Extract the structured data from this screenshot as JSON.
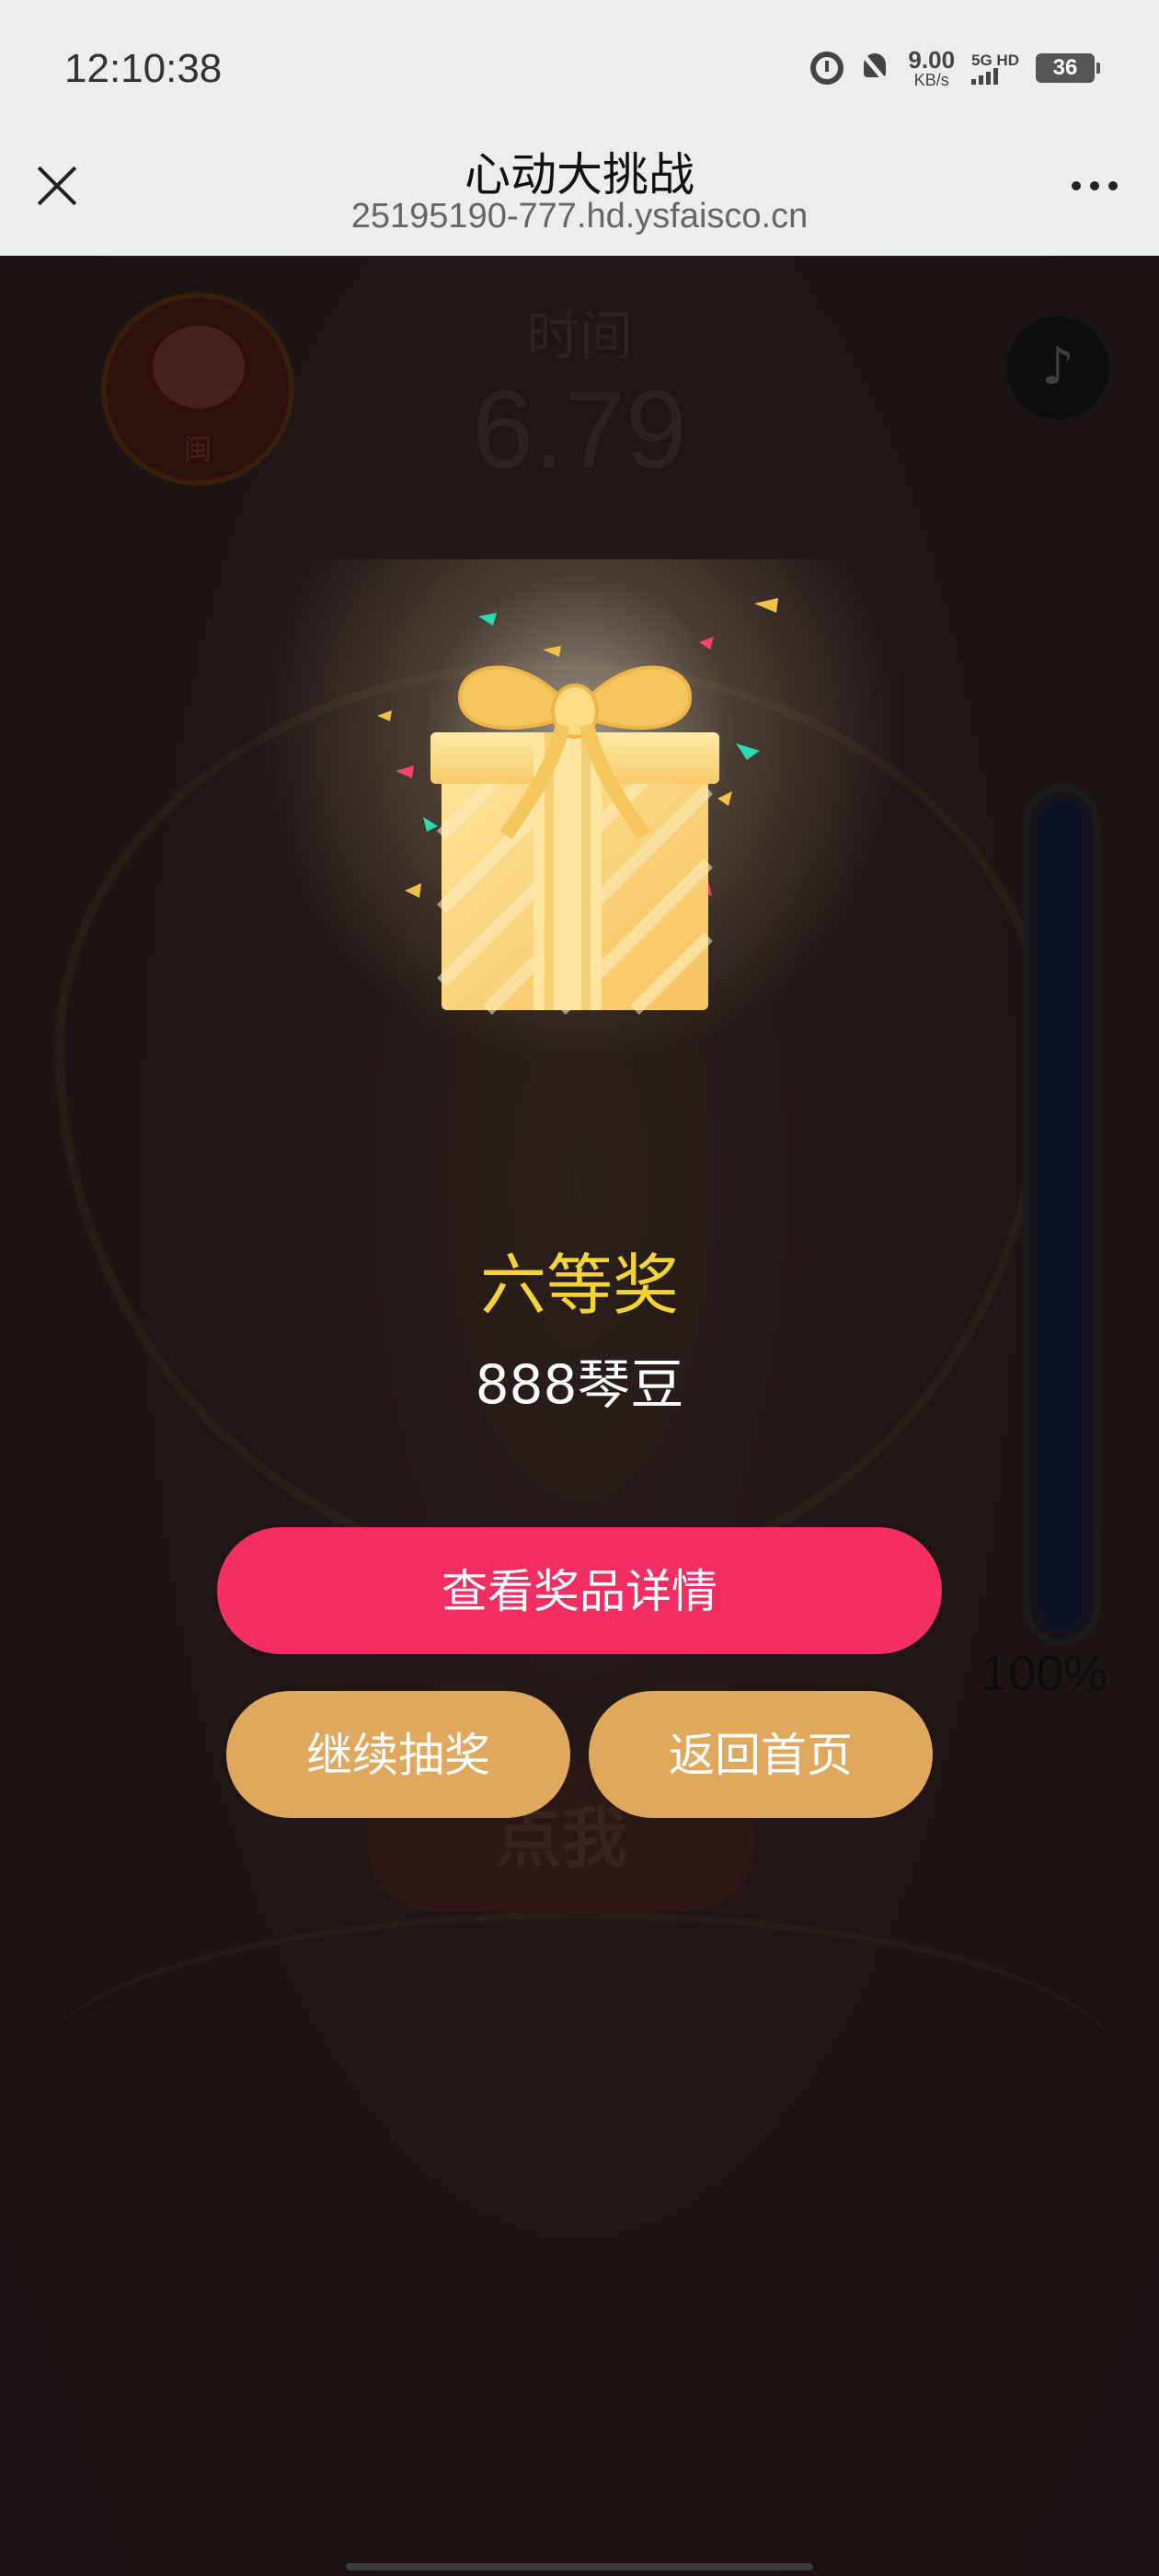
{
  "status_bar": {
    "time": "12:10:38",
    "net_speed_value": "9.00",
    "net_speed_unit": "KB/s",
    "signal_label": "5G HD",
    "battery": "36"
  },
  "nav": {
    "title": "心动大挑战",
    "url": "25195190-777.hd.ysfaisco.cn"
  },
  "game": {
    "time_label": "时间",
    "time_value": "6.79",
    "badge_text": "闽",
    "music_glyph": "♪",
    "tap_label": "点我",
    "meter_percent_label": "100%",
    "meter_fill_fraction": 1.0
  },
  "modal": {
    "prize_title": "六等奖",
    "prize_desc": "888琴豆",
    "view_details_label": "查看奖品详情",
    "continue_label": "继续抽奖",
    "home_label": "返回首页"
  },
  "colors": {
    "primary_button": "#f22e63",
    "secondary_button": "#e0a85d",
    "prize_title": "#f5d437"
  }
}
